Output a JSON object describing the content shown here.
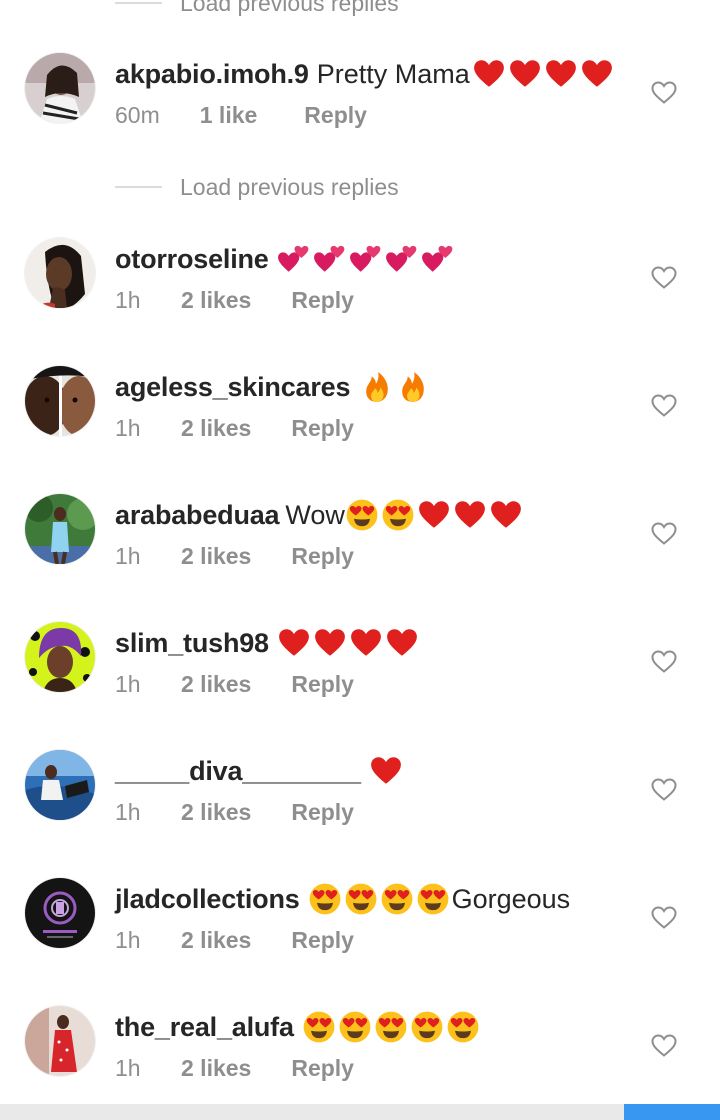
{
  "top_load": {
    "label": "Load previous replies"
  },
  "mid_load": {
    "label": "Load previous replies"
  },
  "like_icon": "heart-outline-icon",
  "comments": [
    {
      "username": "akpabio.imoh.9",
      "text": "Pretty Mama",
      "emojis": [
        "red-heart",
        "red-heart",
        "red-heart",
        "red-heart"
      ],
      "time": "60m",
      "likes": "1 like",
      "reply": "Reply"
    },
    {
      "username": "otorroseline",
      "text": "",
      "emojis": [
        "two-hearts",
        "two-hearts",
        "two-hearts",
        "two-hearts",
        "two-hearts"
      ],
      "time": "1h",
      "likes": "2 likes",
      "reply": "Reply"
    },
    {
      "username": "ageless_skincares",
      "text": "",
      "emojis": [
        "fire",
        "fire"
      ],
      "time": "1h",
      "likes": "2 likes",
      "reply": "Reply"
    },
    {
      "username": "arababeduaa",
      "text": "Wow",
      "emojis": [
        "heart-eyes",
        "heart-eyes",
        "red-heart",
        "red-heart",
        "red-heart"
      ],
      "time": "1h",
      "likes": "2 likes",
      "reply": "Reply"
    },
    {
      "username": "slim_tush98",
      "text": "",
      "emojis": [
        "red-heart",
        "red-heart",
        "red-heart",
        "red-heart"
      ],
      "time": "1h",
      "likes": "2 likes",
      "reply": "Reply"
    },
    {
      "username": "_____diva________",
      "text": "",
      "emojis": [
        "red-heart"
      ],
      "time": "1h",
      "likes": "2 likes",
      "reply": "Reply"
    },
    {
      "username": "jladcollections",
      "text": "Gorgeous",
      "emojis": [
        "heart-eyes",
        "heart-eyes",
        "heart-eyes",
        "heart-eyes"
      ],
      "time": "1h",
      "likes": "2 likes",
      "reply": "Reply"
    },
    {
      "username": "the_real_alufa",
      "text": "",
      "emojis": [
        "heart-eyes",
        "heart-eyes",
        "heart-eyes",
        "heart-eyes",
        "heart-eyes"
      ],
      "time": "1h",
      "likes": "2 likes",
      "reply": "Reply"
    }
  ],
  "colors": {
    "text": "#262626",
    "muted": "#8e8e8e",
    "divider": "#dbdbdb",
    "heart_red": "#e0201f",
    "accent_blue": "#3897f0"
  }
}
